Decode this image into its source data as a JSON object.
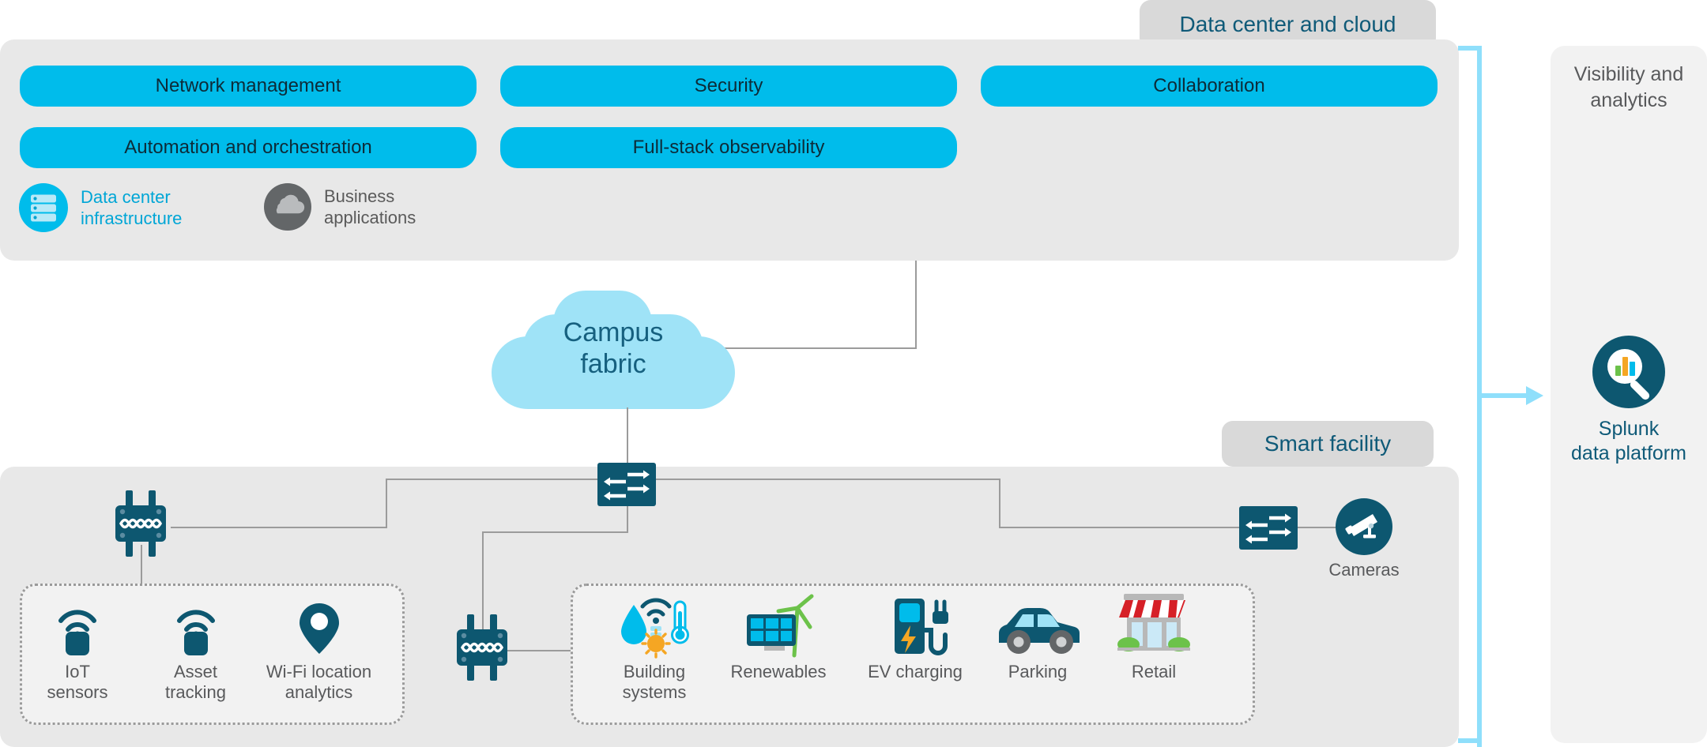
{
  "diagram": {
    "title_hidden": "Cisco smart facility reference architecture",
    "colors": {
      "cisco_cyan": "#00bceb",
      "deep_teal": "#0d5770",
      "panel_gray": "#e8e8e8",
      "panel_light": "#f2f2f2",
      "chip_gray": "#d9d9d9",
      "cloud_blue": "#9fe3f7",
      "bracket_blue": "#8fdffb",
      "wire_gray": "#9b9b9b",
      "caption_gray": "#58595b",
      "title_teal": "#0f5a78",
      "accent_green": "#6cc24a",
      "accent_orange": "#f5a623",
      "accent_red": "#d62027"
    }
  },
  "data_center": {
    "chip_label": "Data center and cloud",
    "pills": [
      {
        "id": "network-management",
        "label": "Network management"
      },
      {
        "id": "security",
        "label": "Security"
      },
      {
        "id": "collaboration",
        "label": "Collaboration"
      },
      {
        "id": "automation-and-orchestration",
        "label": "Automation and orchestration"
      },
      {
        "id": "full-stack-observability",
        "label": "Full-stack observability"
      }
    ],
    "items": [
      {
        "id": "data-center-infrastructure",
        "label": "Data center\ninfrastructure",
        "icon": "server-rack-icon",
        "tone": "cyan"
      },
      {
        "id": "business-applications",
        "label": "Business\napplications",
        "icon": "cloud-app-icon",
        "tone": "gray"
      }
    ]
  },
  "campus": {
    "cloud_label": "Campus\nfabric"
  },
  "smart_facility": {
    "chip_label": "Smart facility",
    "nodes": [
      {
        "id": "core-switch",
        "icon": "network-switch-icon",
        "label": ""
      },
      {
        "id": "access-point-left",
        "icon": "wireless-access-point-icon",
        "label": ""
      },
      {
        "id": "access-point-bottom",
        "icon": "wireless-access-point-icon",
        "label": ""
      },
      {
        "id": "edge-switch",
        "icon": "network-switch-icon",
        "label": ""
      },
      {
        "id": "cameras",
        "icon": "security-camera-icon",
        "label": "Cameras"
      }
    ],
    "wireless_group": [
      {
        "id": "iot-sensors",
        "label": "IoT\nsensors",
        "icon": "iot-sensor-icon"
      },
      {
        "id": "asset-tracking",
        "label": "Asset\ntracking",
        "icon": "asset-tag-icon"
      },
      {
        "id": "wifi-location-analytics",
        "label": "Wi-Fi location\nanalytics",
        "icon": "map-pin-icon"
      }
    ],
    "building_group": [
      {
        "id": "building-systems",
        "label": "Building\nsystems",
        "icon": "building-systems-icon"
      },
      {
        "id": "renewables",
        "label": "Renewables",
        "icon": "renewables-icon"
      },
      {
        "id": "ev-charging",
        "label": "EV charging",
        "icon": "ev-charger-icon"
      },
      {
        "id": "parking",
        "label": "Parking",
        "icon": "car-icon"
      },
      {
        "id": "retail",
        "label": "Retail",
        "icon": "storefront-icon"
      }
    ]
  },
  "visibility": {
    "chip_label": "Visibility and\nanalytics",
    "platform_label": "Splunk\ndata platform",
    "platform_icon": "splunk-magnifier-icon"
  }
}
